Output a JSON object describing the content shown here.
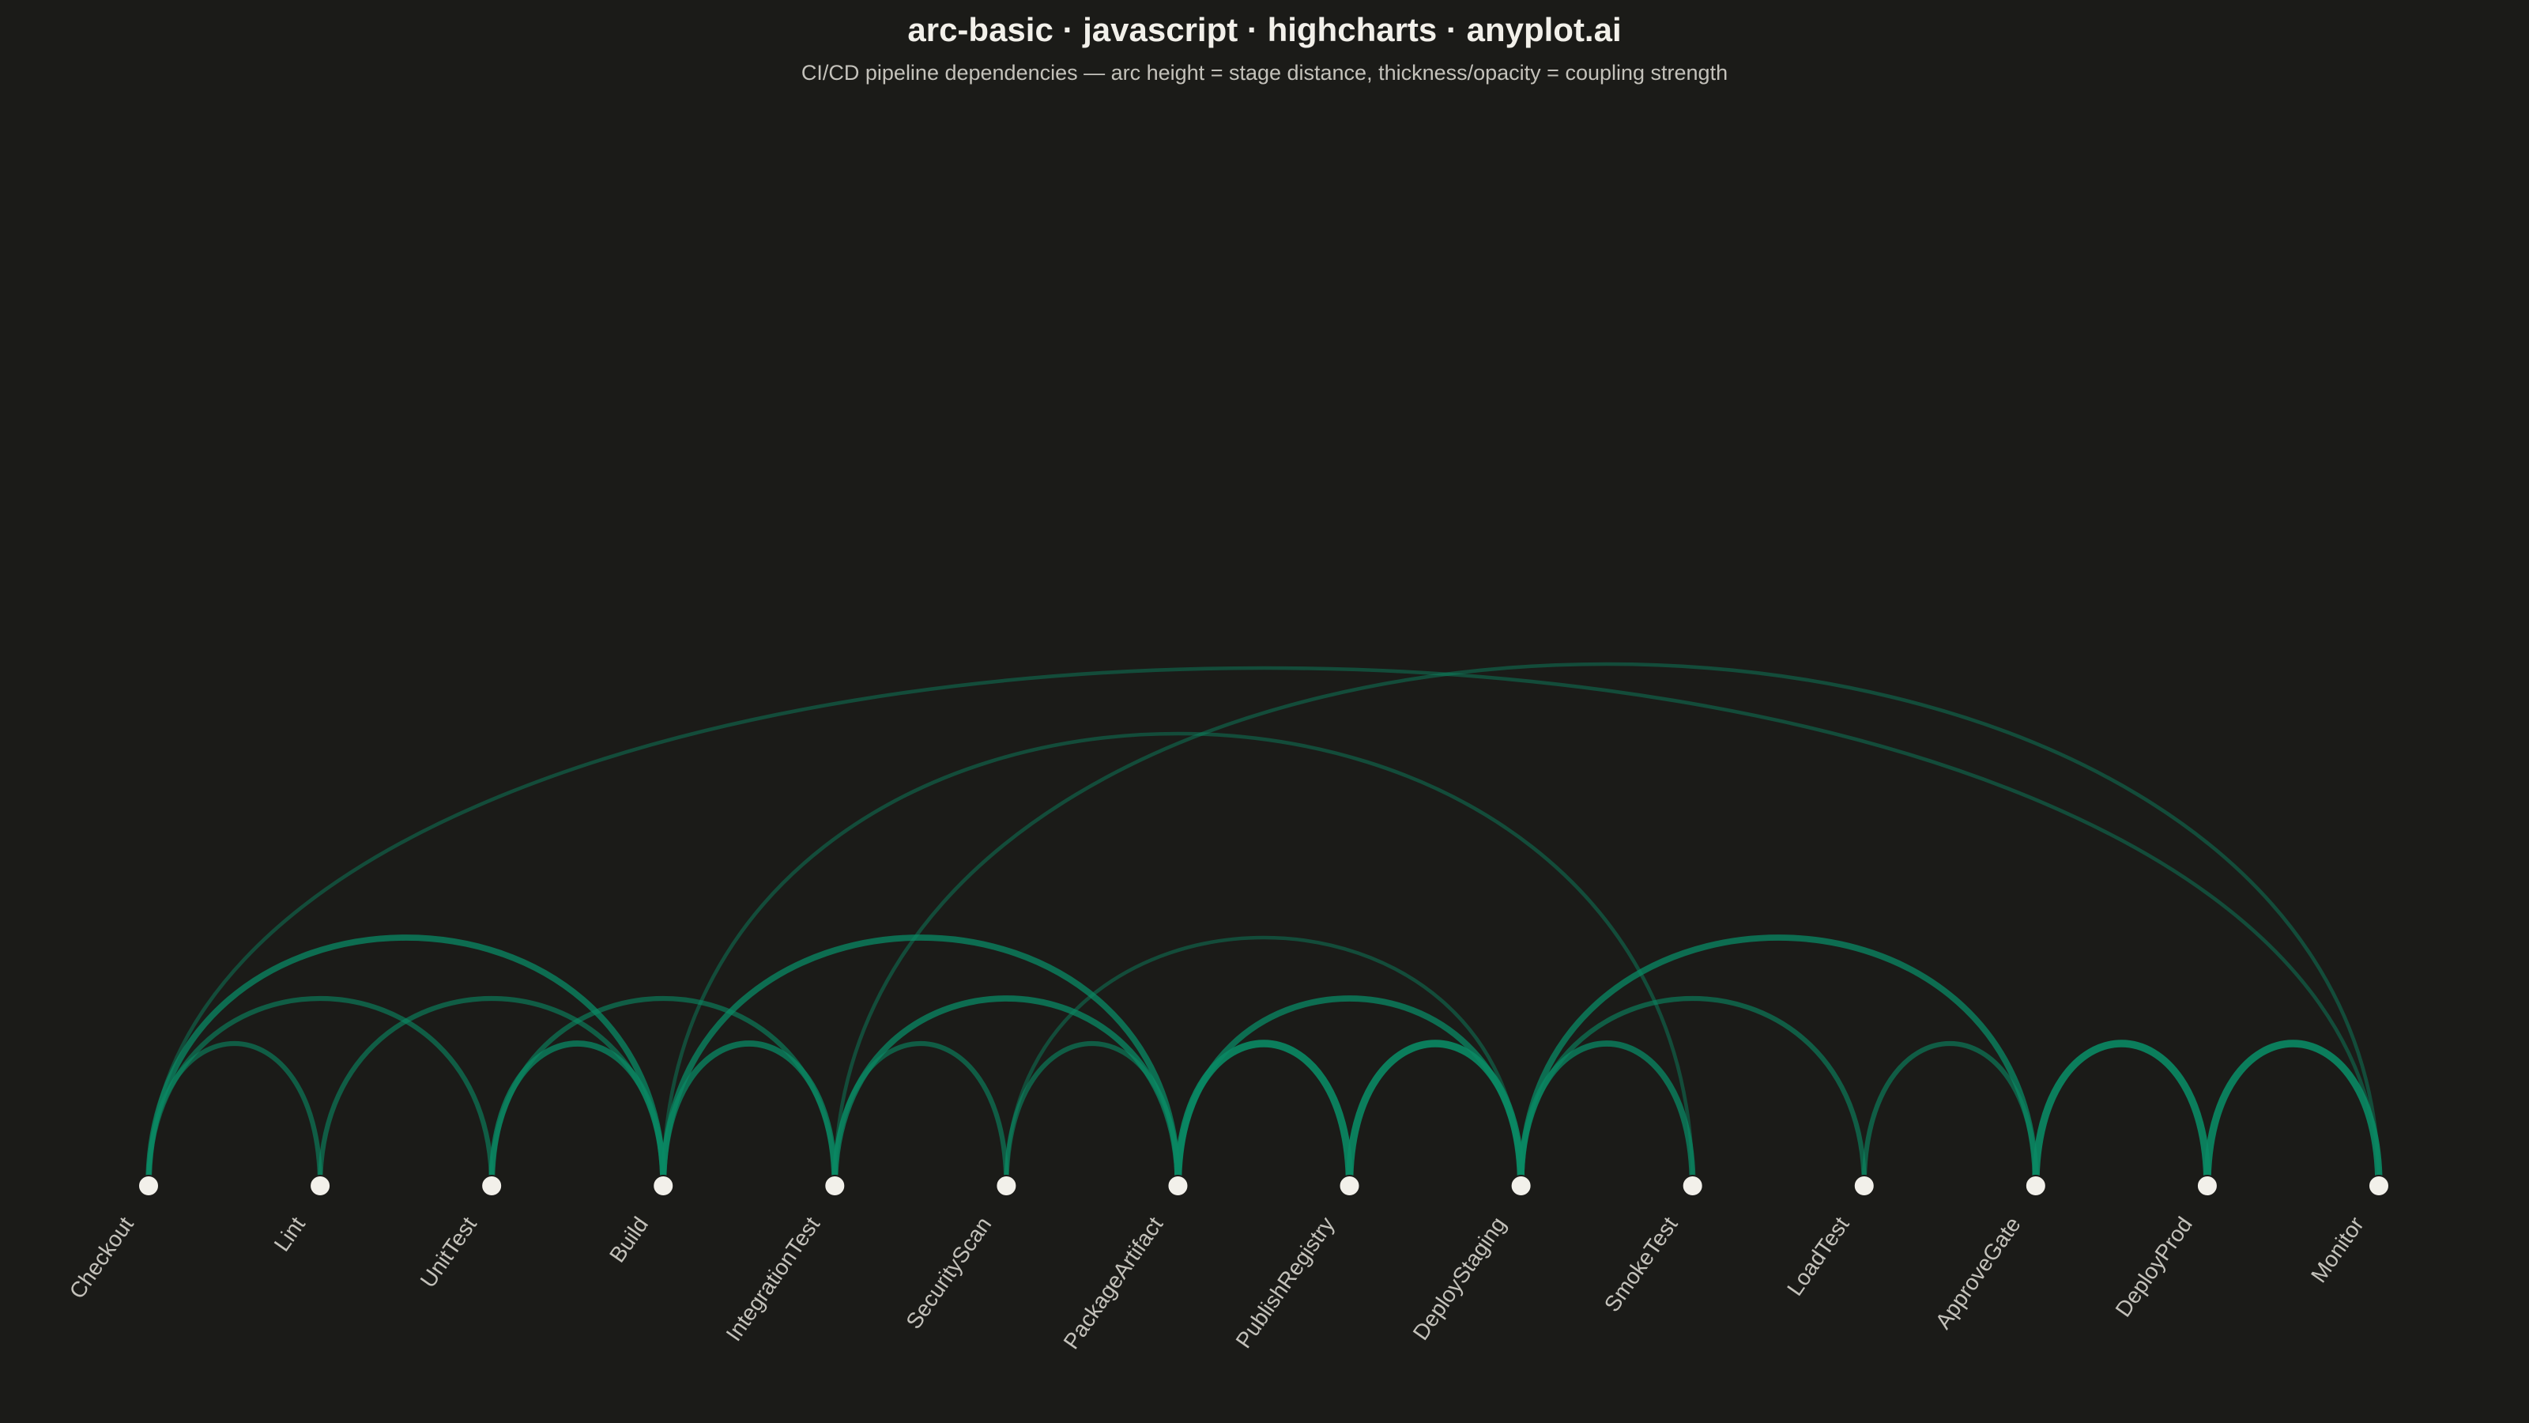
{
  "title": "arc-basic · javascript · highcharts · anyplot.ai",
  "subtitle": "CI/CD pipeline dependencies — arc height = stage distance, thickness/opacity = coupling strength",
  "colors": {
    "background": "#1b1b18",
    "arc": "#0a8a64",
    "node": "#f2f0ea",
    "title": "#f2f0ea",
    "subtitle": "#c4c2bb",
    "label": "#c4c2bb"
  },
  "chart_data": {
    "type": "arc",
    "nodes": [
      "Checkout",
      "Lint",
      "UnitTest",
      "Build",
      "IntegrationTest",
      "SecurityScan",
      "PackageArtifact",
      "PublishRegistry",
      "DeployStaging",
      "SmokeTest",
      "LoadTest",
      "ApproveGate",
      "DeployProd",
      "Monitor"
    ],
    "links": [
      {
        "source": "Checkout",
        "target": "Lint",
        "weight": 2
      },
      {
        "source": "Checkout",
        "target": "UnitTest",
        "weight": 2
      },
      {
        "source": "Checkout",
        "target": "Build",
        "weight": 3
      },
      {
        "source": "Checkout",
        "target": "Monitor",
        "weight": 1
      },
      {
        "source": "Lint",
        "target": "Build",
        "weight": 2
      },
      {
        "source": "UnitTest",
        "target": "Build",
        "weight": 3
      },
      {
        "source": "UnitTest",
        "target": "IntegrationTest",
        "weight": 2
      },
      {
        "source": "Build",
        "target": "IntegrationTest",
        "weight": 3
      },
      {
        "source": "Build",
        "target": "PackageArtifact",
        "weight": 3
      },
      {
        "source": "Build",
        "target": "SmokeTest",
        "weight": 1
      },
      {
        "source": "IntegrationTest",
        "target": "SecurityScan",
        "weight": 2
      },
      {
        "source": "IntegrationTest",
        "target": "PackageArtifact",
        "weight": 3
      },
      {
        "source": "IntegrationTest",
        "target": "Monitor",
        "weight": 1
      },
      {
        "source": "SecurityScan",
        "target": "PackageArtifact",
        "weight": 2
      },
      {
        "source": "SecurityScan",
        "target": "DeployStaging",
        "weight": 1
      },
      {
        "source": "PackageArtifact",
        "target": "PublishRegistry",
        "weight": 4
      },
      {
        "source": "PackageArtifact",
        "target": "DeployStaging",
        "weight": 3
      },
      {
        "source": "PublishRegistry",
        "target": "DeployStaging",
        "weight": 4
      },
      {
        "source": "DeployStaging",
        "target": "SmokeTest",
        "weight": 3
      },
      {
        "source": "DeployStaging",
        "target": "LoadTest",
        "weight": 2
      },
      {
        "source": "DeployStaging",
        "target": "ApproveGate",
        "weight": 3
      },
      {
        "source": "LoadTest",
        "target": "ApproveGate",
        "weight": 2
      },
      {
        "source": "ApproveGate",
        "target": "DeployProd",
        "weight": 4
      },
      {
        "source": "DeployProd",
        "target": "Monitor",
        "weight": 4
      }
    ]
  }
}
